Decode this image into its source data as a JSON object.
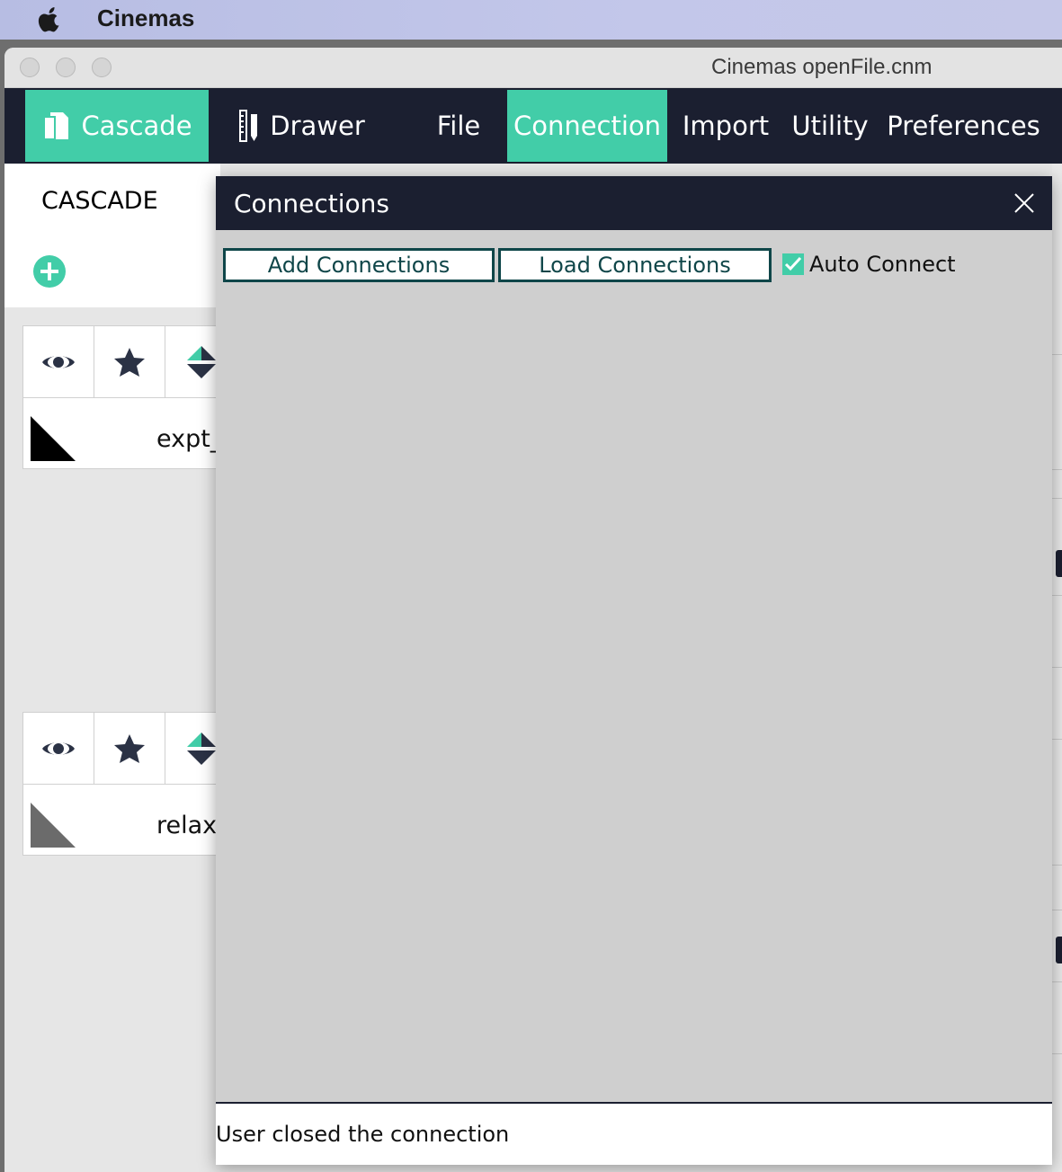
{
  "system_menubar": {
    "app_name": "Cinemas"
  },
  "window": {
    "title": "Cinemas openFile.cnm"
  },
  "toolbar": {
    "items": [
      {
        "label": "Cascade",
        "icon": "documents-icon",
        "active": true
      },
      {
        "label": "Drawer",
        "icon": "drawer-icon",
        "active": false
      },
      {
        "label": "File",
        "active": false
      },
      {
        "label": "Connection",
        "active": true
      },
      {
        "label": "Import",
        "active": false
      },
      {
        "label": "Utility",
        "active": false
      },
      {
        "label": "Preferences",
        "active": false
      }
    ]
  },
  "left_panel": {
    "heading": "CASCADE",
    "add_icon": "plus-circle-icon",
    "cards": [
      {
        "name": "expt_",
        "triangle_color": "#000000",
        "icons": [
          "eye-icon",
          "star-icon",
          "move-arrows-icon"
        ]
      },
      {
        "name": "relax",
        "triangle_color": "#6b6b6b",
        "icons": [
          "eye-icon",
          "star-icon",
          "move-arrows-icon"
        ]
      }
    ]
  },
  "dialog": {
    "title": "Connections",
    "close_icon": "close-icon",
    "add_button": "Add Connections",
    "load_button": "Load Connections",
    "auto_connect": {
      "label": "Auto Connect",
      "checked": true
    },
    "status": "User closed the connection"
  },
  "colors": {
    "accent": "#42cda8",
    "dark": "#1b1f30",
    "button_border": "#0f4649"
  }
}
